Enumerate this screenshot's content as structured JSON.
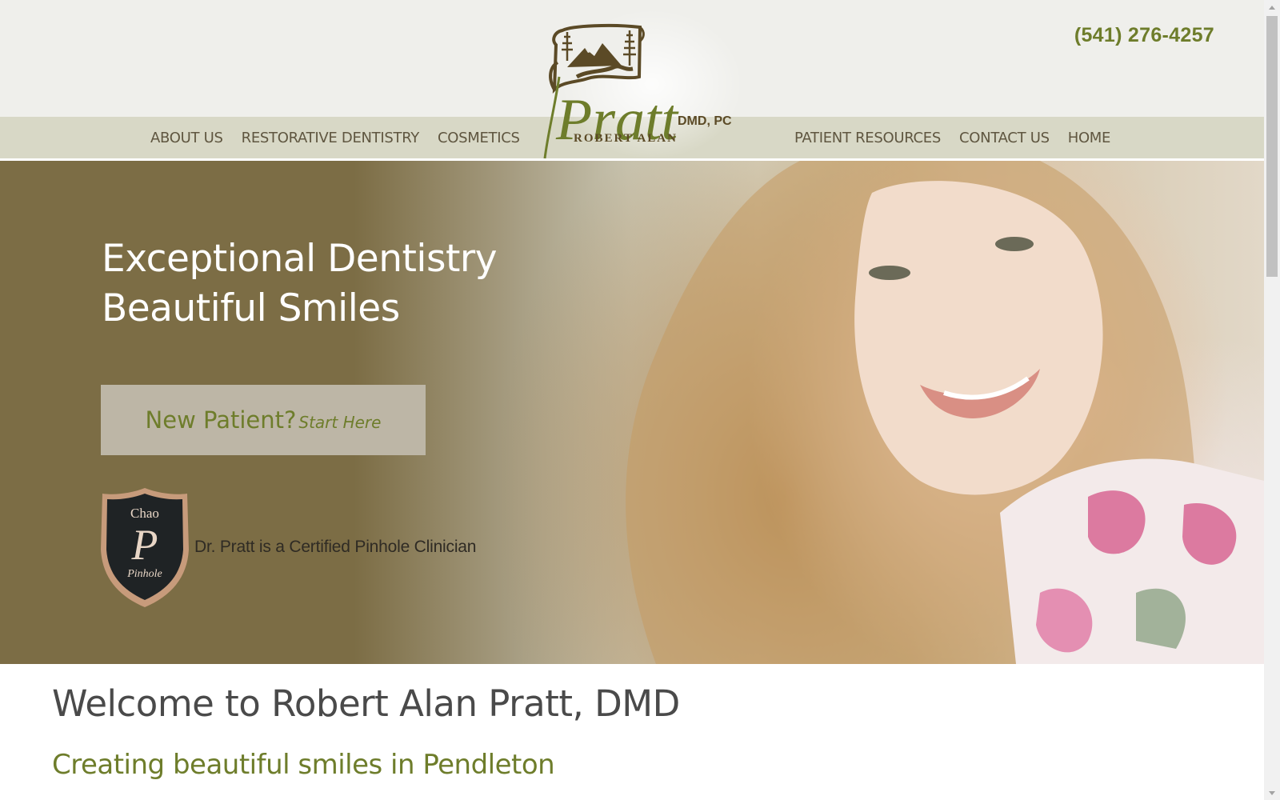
{
  "header": {
    "phone": "(541) 276-4257",
    "logo": {
      "name": "Pratt",
      "suffix": "DMD, PC",
      "firstname": "ROBERT ALAN"
    },
    "nav_left": [
      "ABOUT US",
      "RESTORATIVE DENTISTRY",
      "COSMETICS"
    ],
    "nav_right": [
      "PATIENT RESOURCES",
      "CONTACT US",
      "HOME"
    ]
  },
  "hero": {
    "title_line1": "Exceptional Dentistry",
    "title_line2": "Beautiful Smiles",
    "cta_main": "New Patient?",
    "cta_sub": "Start Here",
    "badge_top": "Chao",
    "badge_letter": "P",
    "badge_bottom": "Pinhole",
    "badge_caption": "Dr. Pratt is a Certified Pinhole Clinician"
  },
  "welcome": {
    "title": "Welcome to Robert Alan Pratt, DMD",
    "subtitle": "Creating beautiful smiles in Pendleton"
  },
  "colors": {
    "accent_green": "#6e7d2b",
    "nav_bar": "#d8d8c6",
    "header_bg": "#efefeb",
    "hero_left": "#7c6d45",
    "logo_brown": "#5b4a26"
  },
  "icons": {
    "logo": "mountain-scroll-logo",
    "badge": "shield-badge-icon"
  }
}
